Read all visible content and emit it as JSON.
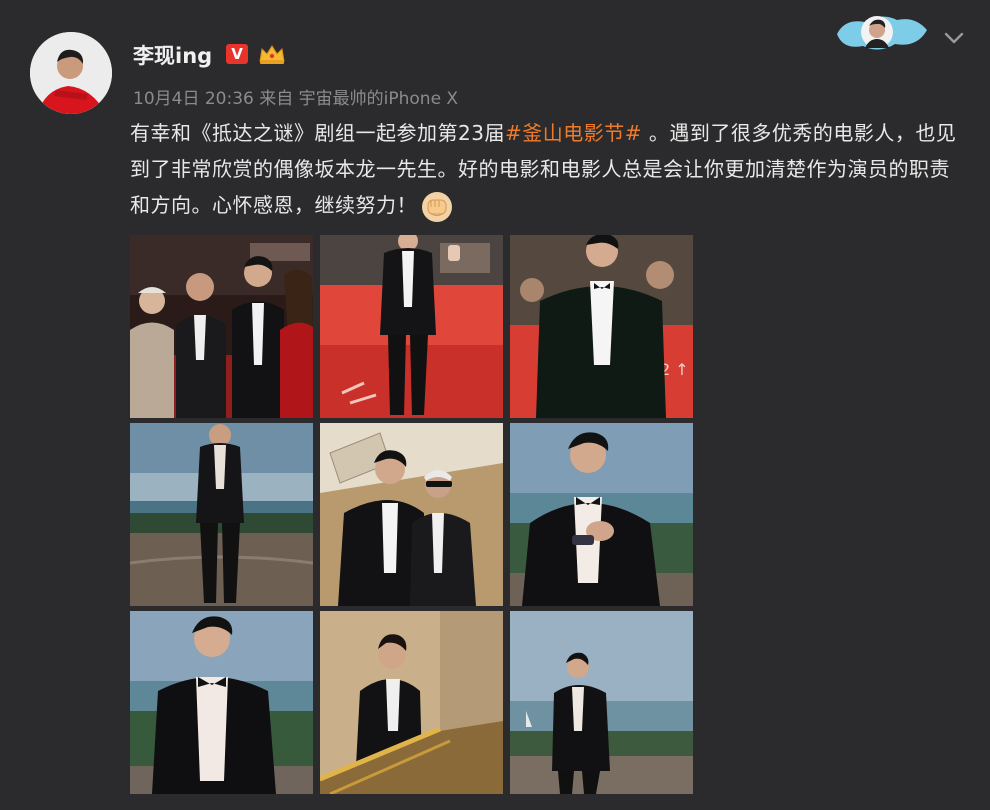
{
  "user": {
    "name": "李现ing",
    "verified_badge": "V",
    "meta": "10月4日 20:36 来自 宇宙最帅的iPhone X"
  },
  "post": {
    "text_before": "有幸和《抵达之谜》剧组一起参加第23届",
    "hashtag": "#釜山电影节#",
    "text_after": " 。遇到了很多优秀的电影人，也见到了非常欣赏的偶像坂本龙一先生。好的电影和电影人总是会让你更加清楚作为演员的职责和方向。心怀感恩，继续努力！"
  },
  "icons": {
    "more": "chevron-down-icon",
    "emoji": "fist-emoji-icon",
    "crown": "crown-icon",
    "membership": "membership-badge-icon"
  },
  "photos": [
    {
      "id": "photo-1",
      "scene": "red-carpet-group"
    },
    {
      "id": "photo-2",
      "scene": "red-carpet-full"
    },
    {
      "id": "photo-3",
      "scene": "red-carpet-half"
    },
    {
      "id": "photo-4",
      "scene": "seaside-full"
    },
    {
      "id": "photo-5",
      "scene": "indoor-duo"
    },
    {
      "id": "photo-6",
      "scene": "seaside-pose"
    },
    {
      "id": "photo-7",
      "scene": "seaside-closeup"
    },
    {
      "id": "photo-8",
      "scene": "stairs"
    },
    {
      "id": "photo-9",
      "scene": "seaside-wide"
    }
  ],
  "colors": {
    "background": "#2b2b2d",
    "hashtag": "#ef7b2a",
    "meta": "#8b8b8e"
  }
}
